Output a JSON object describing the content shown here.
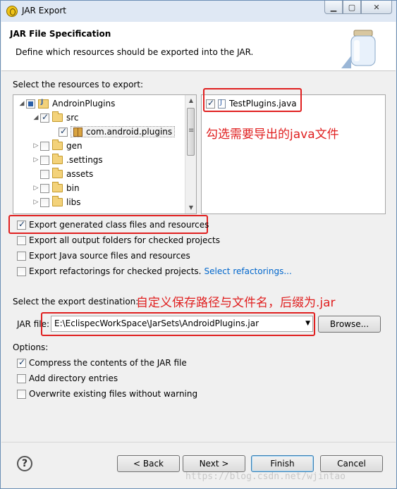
{
  "window": {
    "title": "JAR Export"
  },
  "banner": {
    "title": "JAR File Specification",
    "description": "Define which resources should be exported into the JAR."
  },
  "resources": {
    "label": "Select the resources to export:",
    "tree": [
      {
        "label": "AndroinPlugins",
        "state": "partial",
        "icon": "project-icon",
        "expanded": true
      },
      {
        "label": "src",
        "state": "checked",
        "icon": "package-folder-icon",
        "expanded": true
      },
      {
        "label": "com.android.plugins",
        "state": "checked",
        "icon": "package-icon"
      },
      {
        "label": "gen",
        "state": "unchecked",
        "icon": "package-folder-icon",
        "expanded": false
      },
      {
        "label": ".settings",
        "state": "unchecked",
        "icon": "folder-icon",
        "expanded": false
      },
      {
        "label": "assets",
        "state": "unchecked",
        "icon": "folder-icon"
      },
      {
        "label": "bin",
        "state": "unchecked",
        "icon": "folder-icon",
        "expanded": false
      },
      {
        "label": "libs",
        "state": "unchecked",
        "icon": "folder-icon",
        "expanded": false
      }
    ],
    "files": [
      {
        "label": "TestPlugins.java",
        "state": "checked",
        "icon": "java-file-icon"
      }
    ]
  },
  "annotations": {
    "select_java": "勾选需要导出的java文件",
    "destination": "自定义保存路径与文件名，后缀为.jar"
  },
  "options_top": [
    {
      "label": "Export generated class files and resources",
      "checked": true
    },
    {
      "label": "Export all output folders for checked projects",
      "checked": false
    },
    {
      "label": "Export Java source files and resources",
      "checked": false
    },
    {
      "label": "Export refactorings for checked projects.",
      "checked": false,
      "link": "Select refactorings..."
    }
  ],
  "destination": {
    "label": "Select the export destination:",
    "jar_label": "JAR file:",
    "jar_path": "E:\\EclispecWorkSpace\\JarSets\\AndroidPlugins.jar",
    "browse": "Browse..."
  },
  "options": {
    "label": "Options:",
    "items": [
      {
        "label": "Compress the contents of the JAR file",
        "checked": true
      },
      {
        "label": "Add directory entries",
        "checked": false
      },
      {
        "label": "Overwrite existing files without warning",
        "checked": false
      }
    ]
  },
  "buttons": {
    "back": "< Back",
    "next": "Next >",
    "finish": "Finish",
    "cancel": "Cancel"
  },
  "watermark": "https://blog.csdn.net/wjintao"
}
